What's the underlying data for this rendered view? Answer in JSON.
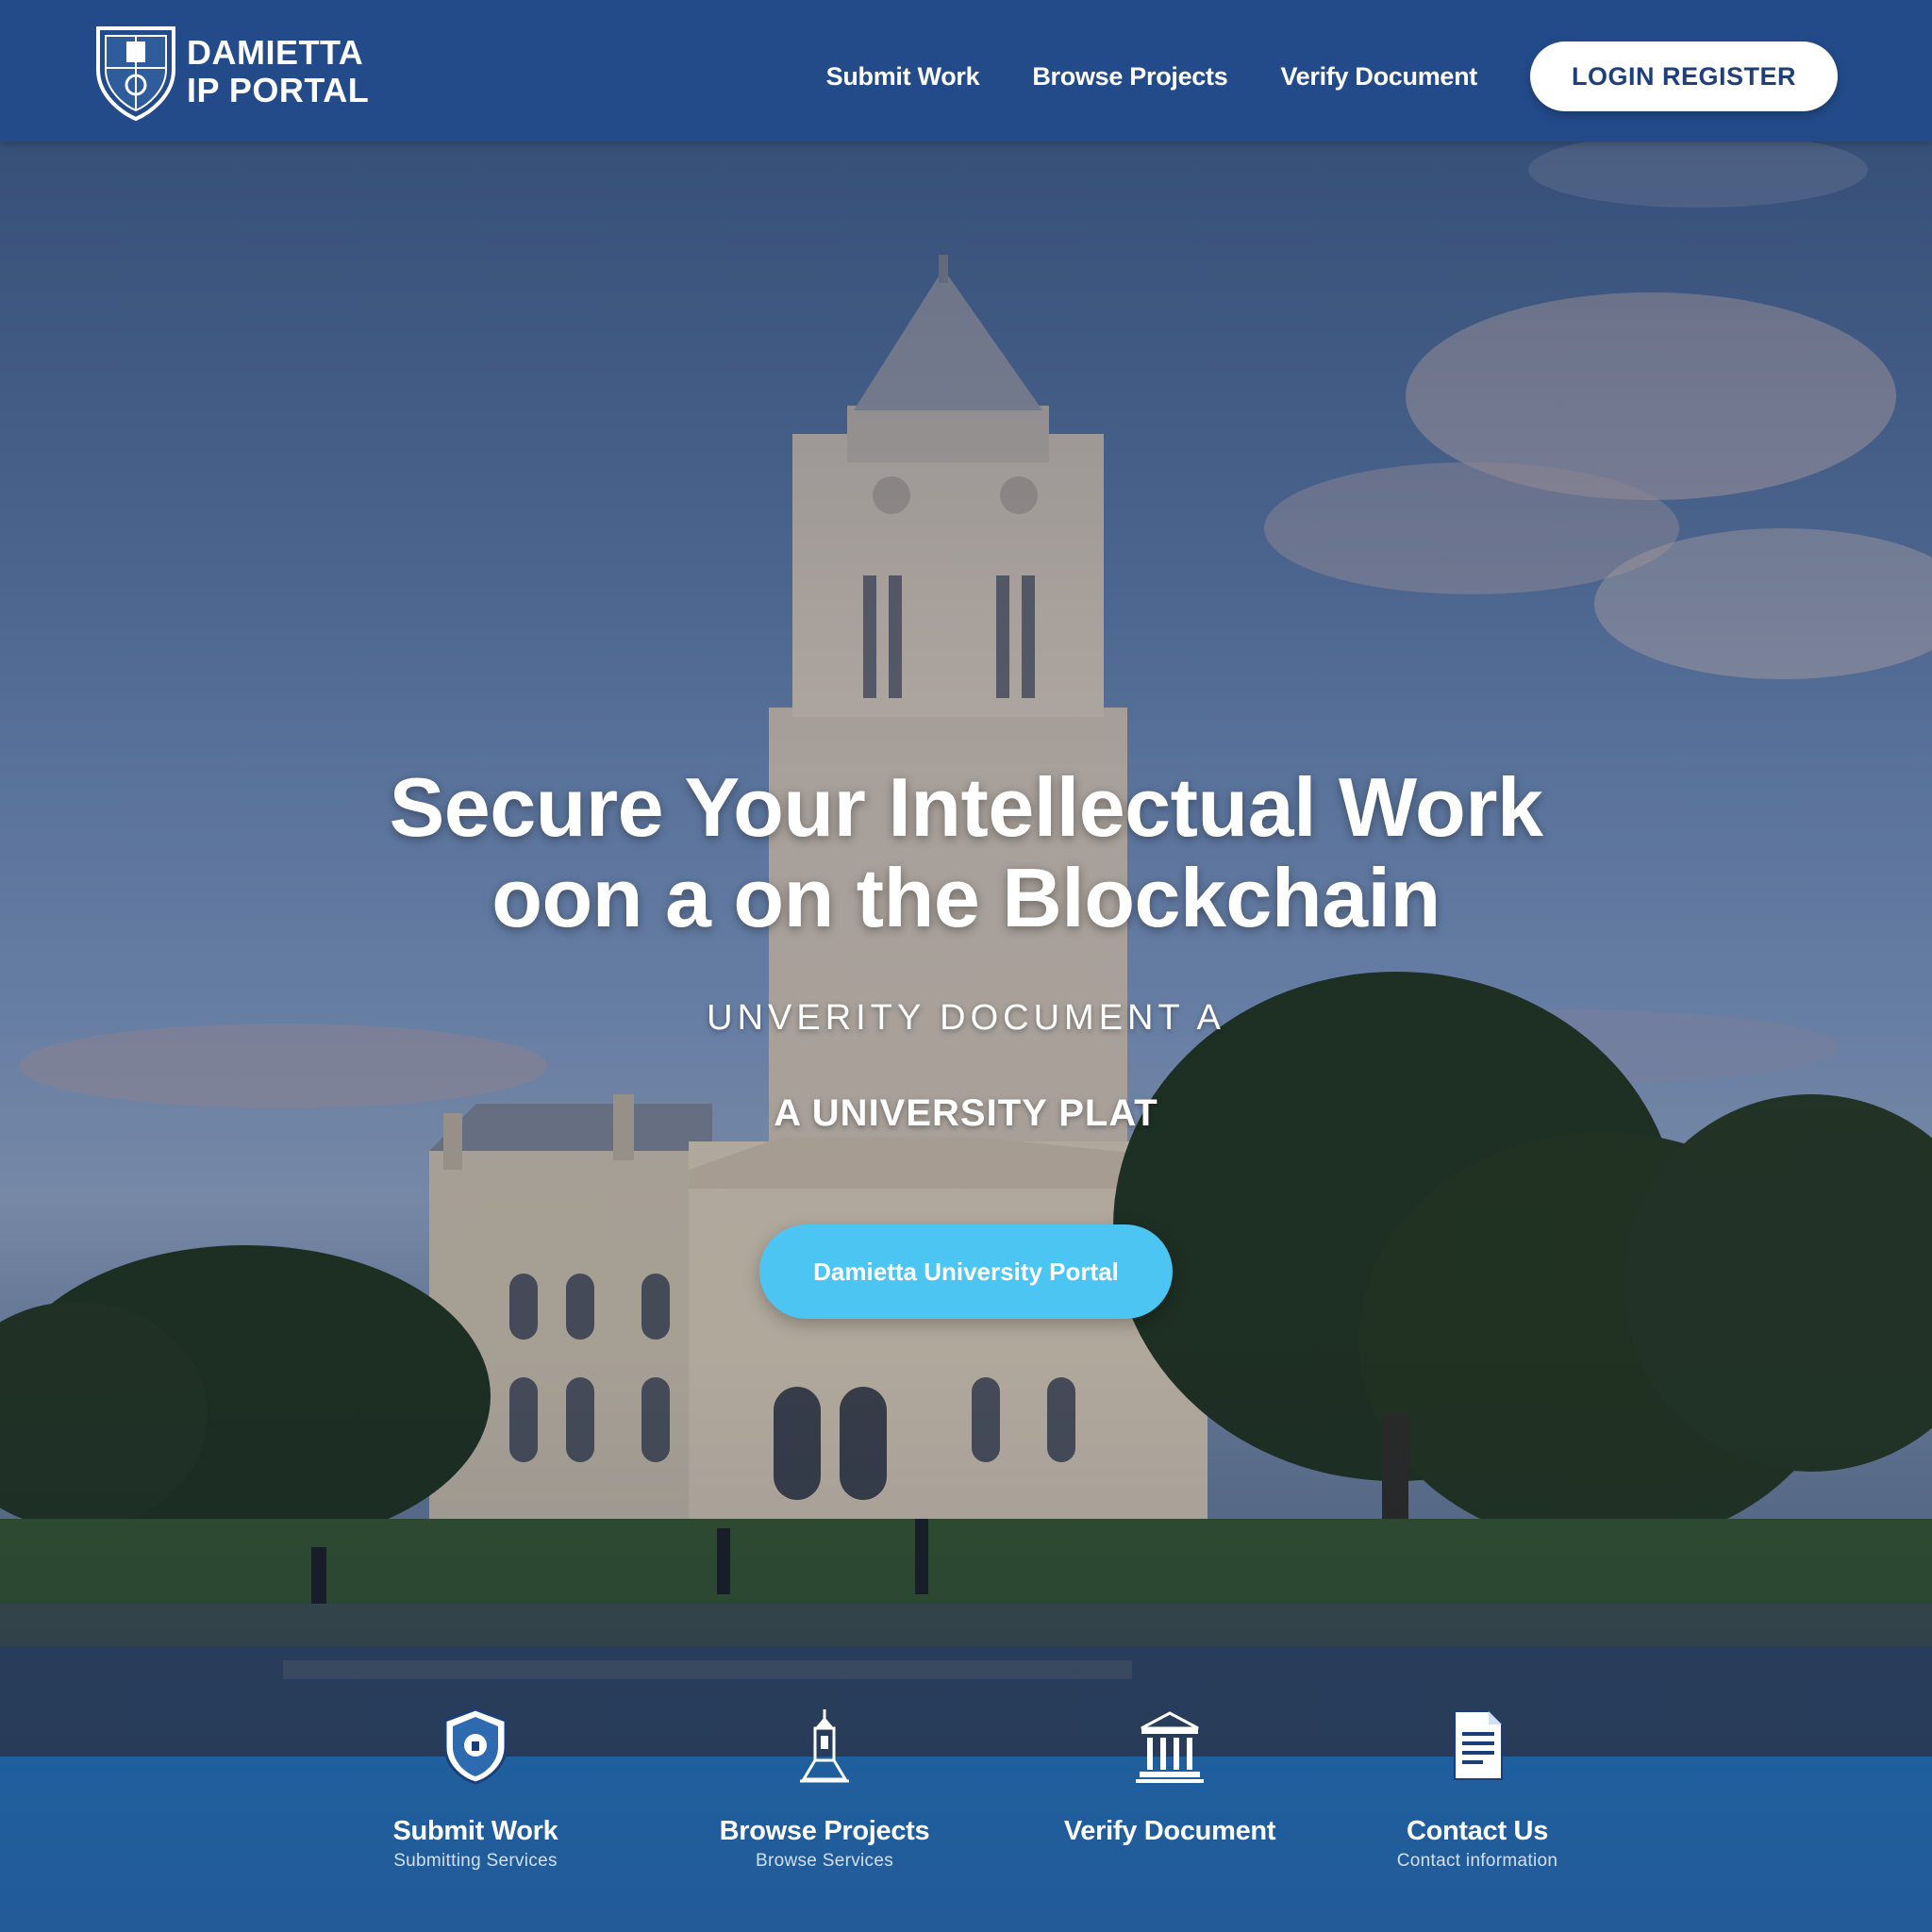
{
  "header": {
    "logo_line1": "DAMIETTA",
    "logo_line2": "IP PORTAL",
    "nav": [
      {
        "label": "Submit Work"
      },
      {
        "label": "Browse Projects"
      },
      {
        "label": "Verify Document"
      }
    ],
    "login_label": "LOGIN REGISTER"
  },
  "hero": {
    "headline_line1": "Secure Your Intellectual Work",
    "headline_line2": "oon a on the Blockchain",
    "tagline": "UNVERITY DOCUMENT  A",
    "subline": "A UNIVERSITY PLAT",
    "cta_label": "Damietta University Portal"
  },
  "features": [
    {
      "title": "Submit Work",
      "subtitle": "Submitting Services",
      "icon": "shield-icon"
    },
    {
      "title": "Browse Projects",
      "subtitle": "Browse Services",
      "icon": "tower-icon"
    },
    {
      "title": "Verify Document",
      "subtitle": "",
      "icon": "building-icon"
    },
    {
      "title": "Contact Us",
      "subtitle": "Contact information",
      "icon": "document-icon"
    }
  ],
  "colors": {
    "header_bg": "#234b8a",
    "cta_bg": "#4cc5f3",
    "feature_bar_bg": "#1f5f9e",
    "text": "#ffffff"
  }
}
